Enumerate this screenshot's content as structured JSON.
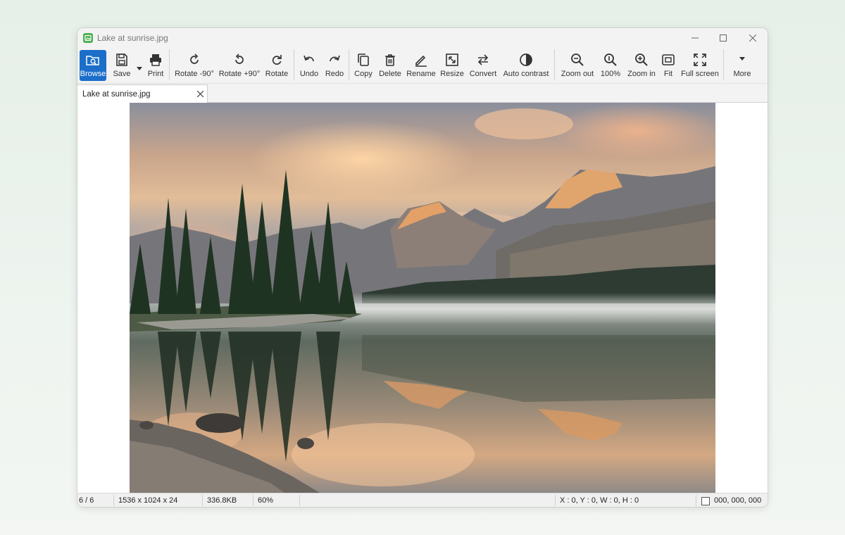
{
  "window": {
    "title": "Lake at sunrise.jpg"
  },
  "toolbar": {
    "items": [
      {
        "label": "Browse",
        "icon": "browse-icon"
      },
      {
        "label": "Save",
        "icon": "save-icon"
      },
      {
        "label": "Print",
        "icon": "print-icon"
      },
      {
        "label": "Rotate -90°",
        "icon": "rotate-left-icon"
      },
      {
        "label": "Rotate +90°",
        "icon": "rotate-right-icon"
      },
      {
        "label": "Rotate",
        "icon": "rotate-icon"
      },
      {
        "label": "Undo",
        "icon": "undo-icon"
      },
      {
        "label": "Redo",
        "icon": "redo-icon"
      },
      {
        "label": "Copy",
        "icon": "copy-icon"
      },
      {
        "label": "Delete",
        "icon": "trash-icon"
      },
      {
        "label": "Rename",
        "icon": "rename-icon"
      },
      {
        "label": "Resize",
        "icon": "resize-icon"
      },
      {
        "label": "Convert",
        "icon": "convert-icon"
      },
      {
        "label": "Auto contrast",
        "icon": "contrast-icon"
      },
      {
        "label": "Zoom out",
        "icon": "zoom-out-icon"
      },
      {
        "label": "100%",
        "icon": "zoom-100-icon"
      },
      {
        "label": "Zoom in",
        "icon": "zoom-in-icon"
      },
      {
        "label": "Fit",
        "icon": "fit-icon"
      },
      {
        "label": "Full screen",
        "icon": "fullscreen-icon"
      },
      {
        "label": "More",
        "icon": "chevron-down-icon"
      }
    ],
    "active": "Browse"
  },
  "tab": {
    "label": "Lake at sunrise.jpg"
  },
  "status": {
    "position": "6 / 6",
    "dimensions": "1536 x 1024 x 24",
    "filesize": "336.8KB",
    "zoom": "60%",
    "selection": "X : 0, Y : 0, W : 0, H : 0",
    "color": "000, 000, 000"
  },
  "colors": {
    "accent": "#1b6ec9",
    "app_icon": "#4caf50"
  }
}
